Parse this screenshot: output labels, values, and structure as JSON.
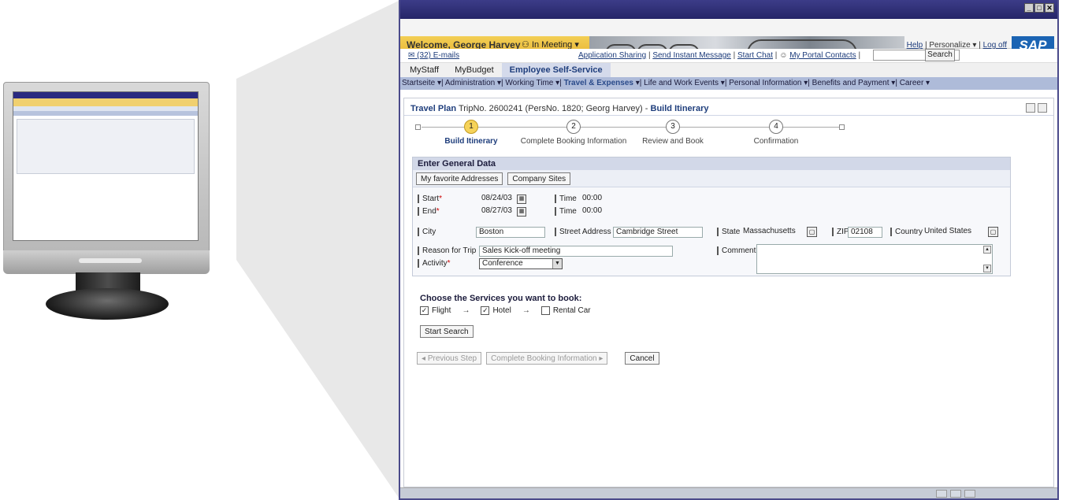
{
  "window": {
    "buttons": [
      "_",
      "□",
      "✕"
    ]
  },
  "header": {
    "welcome": "Welcome, George Harvey",
    "status": "In Meeting",
    "links": [
      "Help",
      "Personalize",
      "Log off"
    ],
    "logo": "SAP"
  },
  "linkbar": {
    "emails": "(32) E-mails",
    "app_sharing": "Application Sharing",
    "send_im": "Send Instant Message",
    "start_chat": "Start Chat",
    "portal_contacts": "My Portal Contacts",
    "search_label": "Search"
  },
  "tabs1": [
    "MyStaff",
    "MyBudget",
    "Employee Self-Service"
  ],
  "tabs2": [
    "Startseite",
    "Administration",
    "Working Time",
    "Travel & Expenses",
    "Life and Work Events",
    "Personal Information",
    "Benefits and Payment",
    "Career"
  ],
  "crumb": {
    "title": "Travel Plan",
    "info": "TripNo. 2600241 (PersNo. 1820; Georg Harvey)",
    "sep": "-",
    "current": "Build Itinerary"
  },
  "steps": [
    {
      "num": "1",
      "label": "Build Itinerary"
    },
    {
      "num": "2",
      "label": "Complete Booking Information"
    },
    {
      "num": "3",
      "label": "Review and Book"
    },
    {
      "num": "4",
      "label": "Confirmation"
    }
  ],
  "form": {
    "group_title": "Enter General Data",
    "fav_btn": "My favorite Addresses",
    "sites_btn": "Company Sites",
    "start_label": "Start",
    "start_date": "08/24/03",
    "end_label": "End",
    "end_date": "08/27/03",
    "time_label": "Time",
    "start_time": "00:00",
    "end_time": "00:00",
    "city_label": "City",
    "city": "Boston",
    "street_label": "Street Address",
    "street": "Cambridge Street",
    "state_label": "State",
    "state": "Massachusetts",
    "zip_label": "ZIP",
    "zip": "02108",
    "country_label": "Country",
    "country": "United States",
    "reason_label": "Reason for Trip",
    "reason": "Sales Kick-off meeting",
    "comment_label": "Comment",
    "activity_label": "Activity",
    "activity": "Conference",
    "req_mark": "*"
  },
  "services": {
    "title": "Choose the  Services you want to book:",
    "flight": "Flight",
    "hotel": "Hotel",
    "rental": "Rental Car",
    "arrow": "→",
    "search_btn": "Start Search"
  },
  "nav": {
    "prev": "Previous Step",
    "next": "Complete Booking Information",
    "cancel": "Cancel"
  }
}
